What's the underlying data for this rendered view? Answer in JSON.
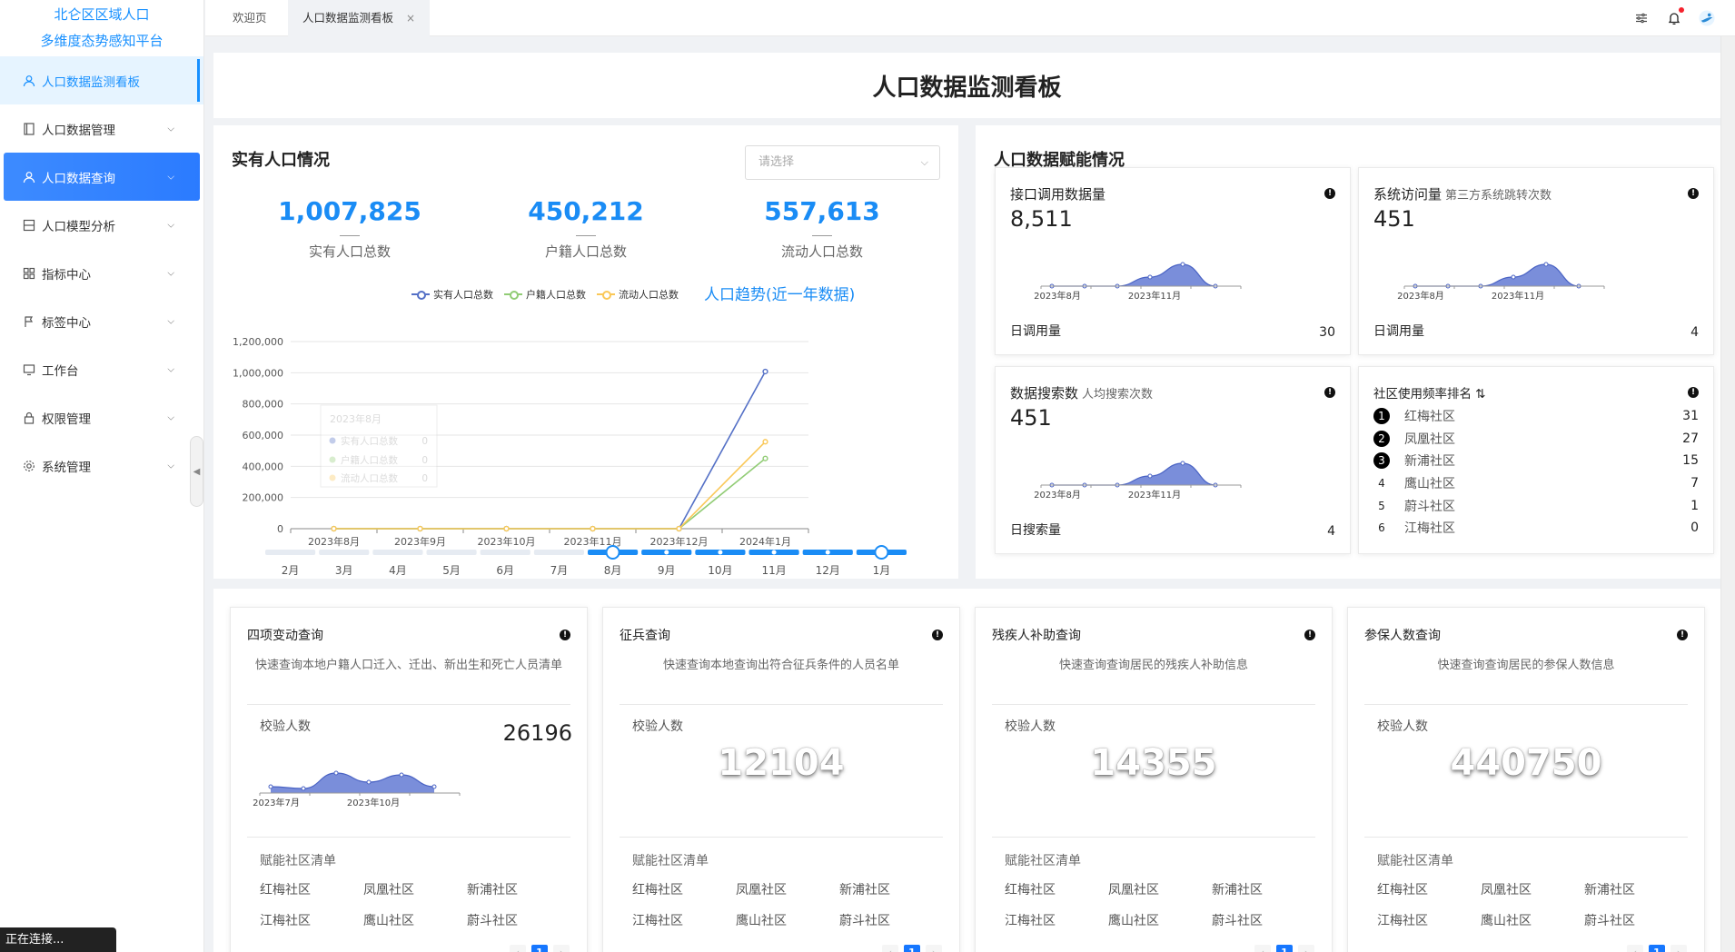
{
  "brand": {
    "line1": "北仑区区域人口",
    "line2": "多维度态势感知平台"
  },
  "sidebar": {
    "items": [
      {
        "label": "人口数据监测看板",
        "icon": "user-icon"
      },
      {
        "label": "人口数据管理",
        "icon": "document-icon"
      },
      {
        "label": "人口数据查询",
        "icon": "user-icon"
      },
      {
        "label": "人口模型分析",
        "icon": "layout-icon"
      },
      {
        "label": "指标中心",
        "icon": "grid-icon"
      },
      {
        "label": "标签中心",
        "icon": "flag-icon"
      },
      {
        "label": "工作台",
        "icon": "monitor-icon"
      },
      {
        "label": "权限管理",
        "icon": "lock-icon"
      },
      {
        "label": "系统管理",
        "icon": "gear-icon"
      }
    ]
  },
  "tabs": [
    {
      "label": "欢迎页"
    },
    {
      "label": "人口数据监测看板"
    }
  ],
  "page_title": "人口数据监测看板",
  "real_population": {
    "title": "实有人口情况",
    "select_placeholder": "请选择",
    "stats": [
      {
        "value": "1,007,825",
        "label": "实有人口总数"
      },
      {
        "value": "450,212",
        "label": "户籍人口总数"
      },
      {
        "value": "557,613",
        "label": "流动人口总数"
      }
    ],
    "legend": [
      "实有人口总数",
      "户籍人口总数",
      "流动人口总数"
    ],
    "trend_label": "人口趋势(近一年数据)",
    "tooltip": {
      "title": "2023年8月",
      "rows": [
        {
          "name": "实有人口总数",
          "value": "0"
        },
        {
          "name": "户籍人口总数",
          "value": "0"
        },
        {
          "name": "流动人口总数",
          "value": "0"
        }
      ]
    },
    "slider_months": [
      "2月",
      "3月",
      "4月",
      "5月",
      "6月",
      "7月",
      "8月",
      "9月",
      "10月",
      "11月",
      "12月",
      "1月"
    ],
    "slider_range": {
      "start": "8月",
      "end": "1月"
    }
  },
  "chart_data": {
    "type": "line",
    "x": [
      "2023年8月",
      "2023年9月",
      "2023年10月",
      "2023年11月",
      "2023年12月",
      "2024年1月"
    ],
    "ylim": [
      0,
      1200000
    ],
    "yticks": [
      "0",
      "200,000",
      "400,000",
      "600,000",
      "800,000",
      "1,000,000",
      "1,200,000"
    ],
    "series": [
      {
        "name": "实有人口总数",
        "color": "#5470c6",
        "values": [
          0,
          0,
          0,
          0,
          0,
          1007825
        ]
      },
      {
        "name": "户籍人口总数",
        "color": "#91cc75",
        "values": [
          0,
          0,
          0,
          0,
          0,
          450212
        ]
      },
      {
        "name": "流动人口总数",
        "color": "#fac858",
        "values": [
          0,
          0,
          0,
          0,
          0,
          557613
        ]
      }
    ]
  },
  "empower": {
    "title": "人口数据赋能情况",
    "api_card": {
      "title": "接口调用数据量",
      "value": "8,511",
      "foot_label": "日调用量",
      "foot_value": "30",
      "axis": [
        "2023年8月",
        "2023年11月"
      ]
    },
    "visit_card": {
      "title": "系统访问量",
      "subtitle": "第三方系统跳转次数",
      "value": "451",
      "foot_label": "日调用量",
      "foot_value": "4",
      "axis": [
        "2023年8月",
        "2023年11月"
      ]
    },
    "search_card": {
      "title": "数据搜索数",
      "subtitle": "人均搜索次数",
      "value": "451",
      "foot_label": "日搜索量",
      "foot_value": "4",
      "axis": [
        "2023年8月",
        "2023年11月"
      ]
    },
    "ranking": {
      "title": "社区使用频率排名",
      "rows": [
        {
          "rank": "1",
          "name": "红梅社区",
          "value": "31"
        },
        {
          "rank": "2",
          "name": "凤凰社区",
          "value": "27"
        },
        {
          "rank": "3",
          "name": "新浦社区",
          "value": "15"
        },
        {
          "rank": "4",
          "name": "鹰山社区",
          "value": "7"
        },
        {
          "rank": "5",
          "name": "蔚斗社区",
          "value": "1"
        },
        {
          "rank": "6",
          "name": "江梅社区",
          "value": "0"
        }
      ]
    }
  },
  "queries": [
    {
      "title": "四项变动查询",
      "desc": "快速查询本地户籍人口迁入、迁出、新出生和死亡人员清单",
      "check_label": "校验人数",
      "value": "26196",
      "axis": [
        "2023年7月",
        "2023年10月"
      ]
    },
    {
      "title": "征兵查询",
      "desc": "快速查询本地查询出符合征兵条件的人员名单",
      "check_label": "校验人数",
      "value": "12104"
    },
    {
      "title": "残疾人补助查询",
      "desc": "快速查询查询居民的残疾人补助信息",
      "check_label": "校验人数",
      "value": "14355"
    },
    {
      "title": "参保人数查询",
      "desc": "快速查询查询居民的参保人数信息",
      "check_label": "校验人数",
      "value": "440750"
    }
  ],
  "community_list_title": "赋能社区清单",
  "communities": [
    "红梅社区",
    "凤凰社区",
    "新浦社区",
    "江梅社区",
    "鹰山社区",
    "蔚斗社区"
  ],
  "pager": {
    "prev": "‹",
    "current": "1",
    "next": "›"
  },
  "status": "正在连接..."
}
